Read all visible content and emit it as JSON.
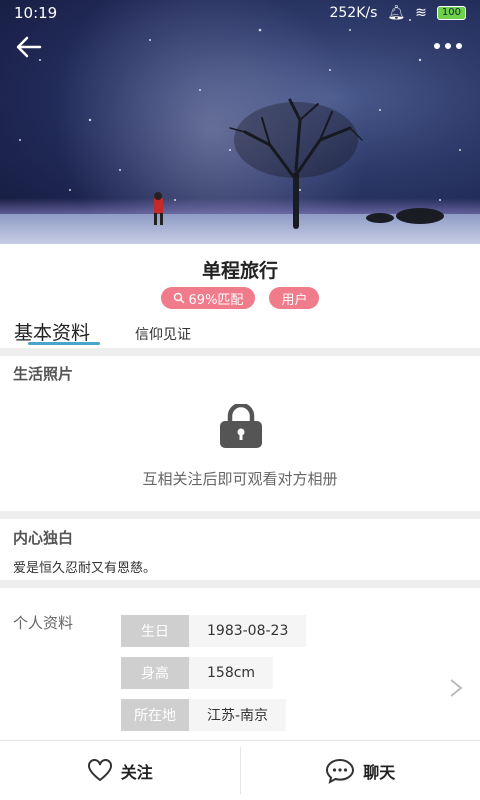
{
  "status_bar": {
    "time": "10:19",
    "network_speed": "252K/s",
    "battery": "100"
  },
  "profile": {
    "name": "单程旅行",
    "match_tag": "69%匹配",
    "user_tag": "用户"
  },
  "tabs": [
    {
      "label": "基本资料",
      "active": true
    },
    {
      "label": "信仰见证",
      "active": false
    }
  ],
  "photos": {
    "title": "生活照片",
    "locked_text": "互相关注后即可观看对方相册"
  },
  "monologue": {
    "title": "内心独白",
    "text": "爱是恒久忍耐又有恩慈。"
  },
  "details": {
    "title": "个人资料",
    "rows": [
      {
        "key": "生日",
        "value": "1983-08-23"
      },
      {
        "key": "身高",
        "value": "158cm"
      },
      {
        "key": "所在地",
        "value": "江苏-南京"
      }
    ]
  },
  "bottom_bar": {
    "follow_label": "关注",
    "chat_label": "聊天"
  },
  "colors": {
    "tag_pink": "#f07b8a",
    "tab_underline": "#4aa3c9"
  }
}
